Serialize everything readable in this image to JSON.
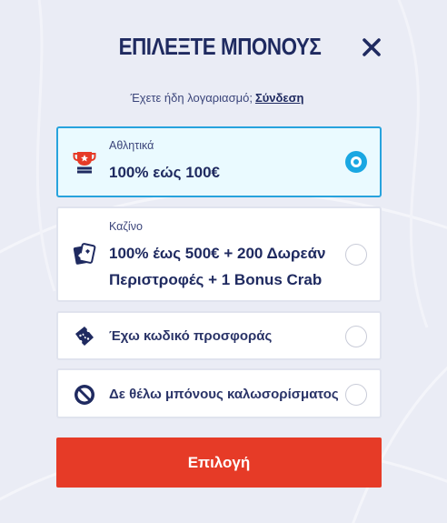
{
  "modal": {
    "title": "ΕΠΙΛΕΞΤΕ ΜΠΟΝΟΥΣ",
    "close_icon": "close-icon"
  },
  "login": {
    "prompt": "Έχετε ήδη λογαριασμό;",
    "link": "Σύνδεση"
  },
  "options": [
    {
      "category": "Αθλητικά",
      "title": "100% εώς 100€",
      "icon": "trophy-icon",
      "selected": true
    },
    {
      "category": "Καζίνο",
      "title_line1": "100% έως 500€ + 200 Δωρεάν",
      "title_line2": "Περιστροφές + 1 Bonus Crab",
      "icon": "casino-cards-icon",
      "selected": false
    },
    {
      "title": "Έχω κωδικό προσφοράς",
      "icon": "ticket-icon",
      "selected": false
    },
    {
      "title": "Δε θέλω μπόνους καλωσορίσματος",
      "icon": "no-entry-icon",
      "selected": false
    }
  ],
  "submit": {
    "label": "Επιλογή"
  },
  "colors": {
    "accent_blue": "#1aa7e2",
    "primary_navy": "#1f2a60",
    "button_red": "#e63b27",
    "selected_bg": "#eafaff"
  }
}
